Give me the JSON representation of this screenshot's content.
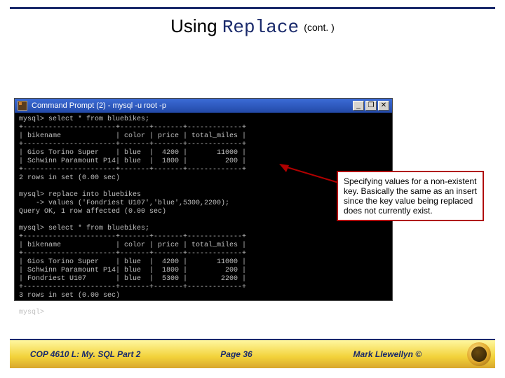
{
  "title": {
    "prefix": "Using ",
    "command": "Replace",
    "suffix": "(cont. )"
  },
  "terminal": {
    "window_title": "Command Prompt (2) - mysql -u root -p",
    "buttons": {
      "min": "_",
      "max": "❐",
      "close": "✕"
    },
    "lines": [
      "mysql> select * from bluebikes;",
      "+----------------------+-------+-------+-------------+",
      "| bikename             | color | price | total_miles |",
      "+----------------------+-------+-------+-------------+",
      "| Gios Torino Super    | blue  |  4200 |       11000 |",
      "| Schwinn Paramount P14| blue  |  1800 |         200 |",
      "+----------------------+-------+-------+-------------+",
      "2 rows in set (0.00 sec)",
      "",
      "mysql> replace into bluebikes",
      "    -> values ('Fondriest U107','blue',5300,2200);",
      "Query OK, 1 row affected (0.00 sec)",
      "",
      "mysql> select * from bluebikes;",
      "+----------------------+-------+-------+-------------+",
      "| bikename             | color | price | total_miles |",
      "+----------------------+-------+-------+-------------+",
      "| Gios Torino Super    | blue  |  4200 |       11000 |",
      "| Schwinn Paramount P14| blue  |  1800 |         200 |",
      "| Fondriest U107       | blue  |  5300 |        2200 |",
      "+----------------------+-------+-------+-------------+",
      "3 rows in set (0.00 sec)",
      "",
      "mysql>"
    ]
  },
  "callout": {
    "text": "Specifying values for a non-existent key.  Basically the same as an insert since the key value being replaced does not currently exist."
  },
  "footer": {
    "left": "COP 4610 L: My. SQL Part 2",
    "center": "Page 36",
    "right": "Mark Llewellyn ©"
  }
}
